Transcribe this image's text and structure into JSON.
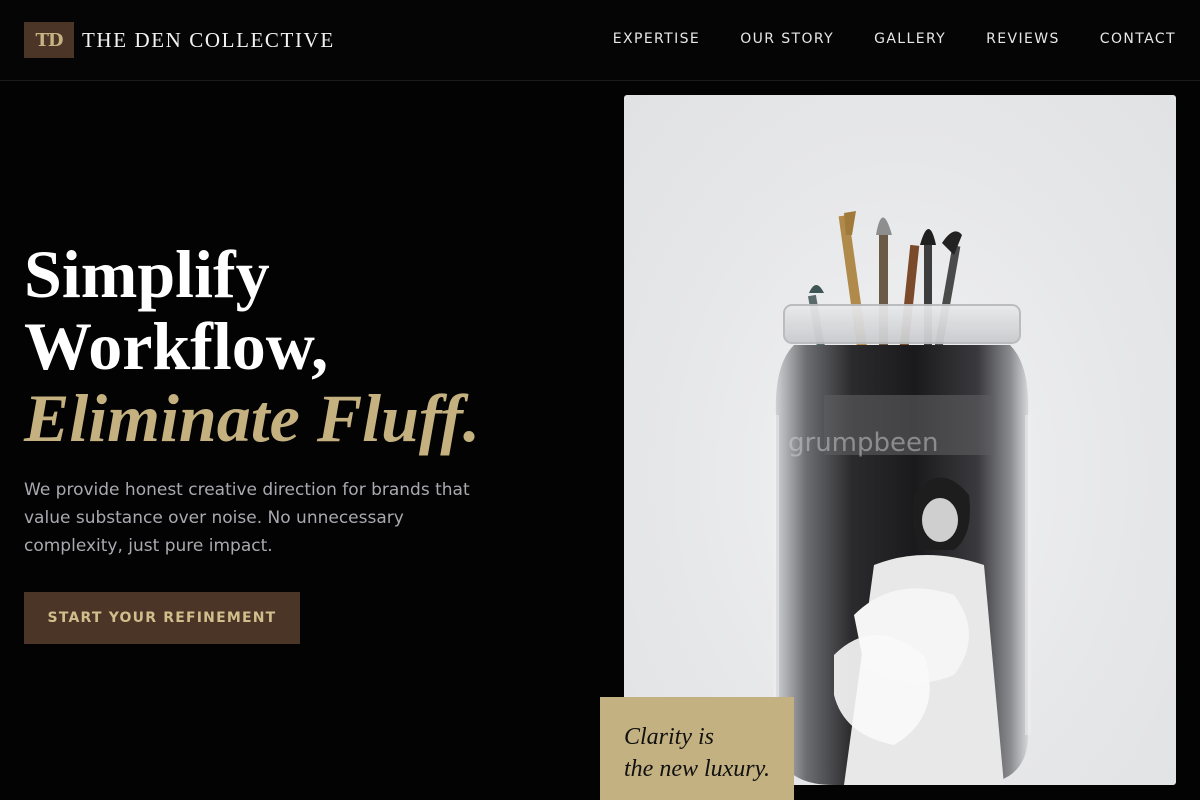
{
  "brand": {
    "mark": "TD",
    "name": "THE DEN COLLECTIVE"
  },
  "nav": {
    "items": [
      "EXPERTISE",
      "OUR STORY",
      "GALLERY",
      "REVIEWS",
      "CONTACT"
    ]
  },
  "hero": {
    "title_line1": "Simplify",
    "title_line2": "Workflow,",
    "title_accent": "Eliminate Fluff.",
    "description": "We provide honest creative direction for brands that value substance over noise. No unnecessary complexity, just pure impact.",
    "cta_label": "START YOUR REFINEMENT"
  },
  "feature_image": {
    "subject": "glass jar with paint brushes and a black-and-white photo",
    "watermark": "grumpbeen"
  },
  "quote_card": {
    "text": "Clarity is\nthe new luxury."
  },
  "colors": {
    "background": "#030303",
    "accent_gold": "#c4b17f",
    "accent_brown": "#4b3526",
    "muted_text": "#a9a9b0"
  }
}
